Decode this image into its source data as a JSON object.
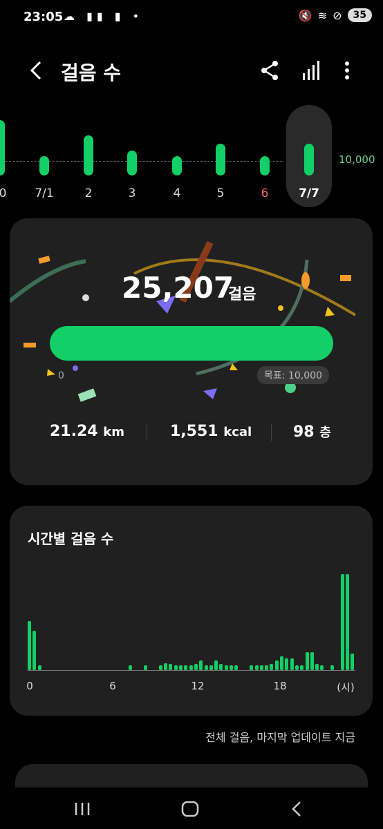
{
  "status": {
    "time": "23:05",
    "battery": "35"
  },
  "header": {
    "title": "걸음 수"
  },
  "weekly": {
    "goal_label": "10,000",
    "days": [
      {
        "label": "0",
        "value": 1.0,
        "red": false
      },
      {
        "label": "7/1",
        "value": 0.35,
        "red": false
      },
      {
        "label": "2",
        "value": 0.72,
        "red": false
      },
      {
        "label": "3",
        "value": 0.45,
        "red": false
      },
      {
        "label": "4",
        "value": 0.3,
        "red": false
      },
      {
        "label": "5",
        "value": 0.58,
        "red": false
      },
      {
        "label": "6",
        "value": 0.33,
        "red": true
      },
      {
        "label": "7/7",
        "value": 0.58,
        "red": false
      }
    ]
  },
  "today": {
    "steps": "25,207",
    "steps_unit": "걸음",
    "zero_label": "0",
    "goal_chip": "목표: 10,000",
    "distance_value": "21.24",
    "distance_unit": "km",
    "calories_value": "1,551",
    "calories_unit": "kcal",
    "floors_value": "98",
    "floors_unit": "층",
    "colors": {
      "accent": "#12cf67"
    }
  },
  "hourly": {
    "title": "시간별 걸음 수",
    "x_labels": [
      "0",
      "6",
      "12",
      "18",
      "(시)"
    ],
    "bars": [
      0.5,
      0.4,
      0.05,
      0,
      0,
      0,
      0,
      0,
      0,
      0,
      0,
      0,
      0,
      0,
      0,
      0,
      0,
      0,
      0,
      0,
      0.05,
      0,
      0,
      0.05,
      0,
      0,
      0.05,
      0.07,
      0.06,
      0.05,
      0.05,
      0.05,
      0.05,
      0.06,
      0.1,
      0.05,
      0.05,
      0.1,
      0.06,
      0.05,
      0.05,
      0.05,
      0,
      0,
      0.05,
      0.05,
      0.05,
      0.05,
      0.06,
      0.1,
      0.14,
      0.12,
      0.12,
      0.05,
      0.05,
      0.18,
      0.18,
      0.06,
      0.05,
      0,
      0.05,
      0,
      0.98,
      0.98,
      0.17
    ]
  },
  "footer": {
    "note": "전체 걸음, 마지막 업데이트 지금"
  }
}
